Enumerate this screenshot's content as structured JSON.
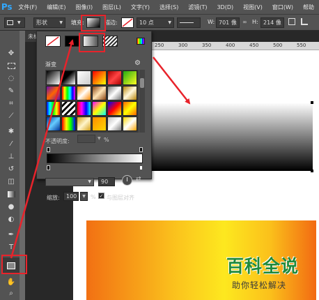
{
  "app": {
    "logo": "Ps",
    "menu": [
      "文件(F)",
      "编辑(E)",
      "图像(I)",
      "图层(L)",
      "文字(Y)",
      "选择(S)",
      "滤镜(T)",
      "3D(D)",
      "视图(V)",
      "窗口(W)",
      "帮助"
    ]
  },
  "options_bar": {
    "shape_mode": "形状",
    "fill_label": "填充:",
    "stroke_label": "描边:",
    "stroke_size": "10 点",
    "width_label": "W:",
    "width_value": "701 像",
    "height_label": "H:",
    "height_value": "214 像"
  },
  "document": {
    "tab_label": "未标",
    "ruler_numbers": [
      "250",
      "300",
      "350",
      "400",
      "450",
      "500",
      "550"
    ]
  },
  "gradient_panel": {
    "label": "渐变",
    "opacity_label": "不透明度:",
    "opacity_unit": "%",
    "location_value": "90",
    "scale_label": "缩放:",
    "scale_value": "100",
    "scale_unit": "%",
    "align_label": "与图层对齐",
    "align_checked": true
  },
  "watermark": {
    "title": "百科全说",
    "subtitle": "助你轻松解决"
  },
  "colors": {
    "annotation_red": "#e8232b",
    "watermark_green": "#1f8a3b"
  }
}
